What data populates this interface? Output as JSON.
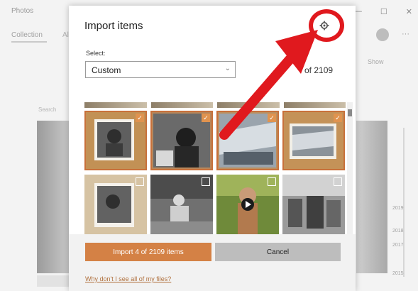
{
  "background_app": {
    "title": "Photos",
    "tab_collection": "Collection",
    "tab_second": "Al",
    "search_hint": "Search",
    "show_label": "Show",
    "window_buttons": [
      "—",
      "☐",
      "✕"
    ],
    "timeline_years": [
      "2019",
      "2018",
      "2017",
      "2015"
    ]
  },
  "dialog": {
    "title": "Import items",
    "select_label": "Select:",
    "select_value": "Custom",
    "count_text": "of 2109",
    "import_button": "Import 4 of 2109 items",
    "cancel_button": "Cancel",
    "help_link": "Why don't I see all of my files?",
    "settings_icon": "gear-icon"
  },
  "thumbnails": [
    {
      "selected": true
    },
    {
      "selected": true
    },
    {
      "selected": true
    },
    {
      "selected": true
    },
    {
      "selected": false
    },
    {
      "selected": false
    },
    {
      "selected": false
    },
    {
      "selected": false
    }
  ],
  "colors": {
    "accent": "#d48145",
    "annotation_red": "#e0191e",
    "cancel_bg": "#bdbdbd"
  }
}
